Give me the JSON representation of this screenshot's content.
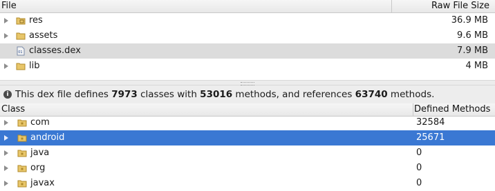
{
  "file_table": {
    "headers": {
      "file": "File",
      "size": "Raw File Size"
    },
    "rows": [
      {
        "name": "res",
        "size": "36.9 MB",
        "icon": "resource-folder-icon"
      },
      {
        "name": "assets",
        "size": "9.6 MB",
        "icon": "folder-icon"
      },
      {
        "name": "classes.dex",
        "size": "7.9 MB",
        "icon": "dex-file-icon"
      },
      {
        "name": "lib",
        "size": "4 MB",
        "icon": "folder-icon"
      }
    ]
  },
  "info_bar": {
    "prefix": "This dex file defines ",
    "classes": "7973",
    "mid1": " classes with ",
    "methods": "53016",
    "mid2": " methods, and references ",
    "references": "63740",
    "suffix": " methods."
  },
  "class_table": {
    "headers": {
      "class": "Class",
      "methods": "Defined Methods"
    },
    "rows": [
      {
        "name": "com",
        "count": "32584"
      },
      {
        "name": "android",
        "count": "25671"
      },
      {
        "name": "java",
        "count": "0"
      },
      {
        "name": "org",
        "count": "0"
      },
      {
        "name": "javax",
        "count": "0"
      }
    ]
  },
  "colors": {
    "selection_blue": "#3a78d3",
    "selection_gray": "#dcdcdc",
    "folder": "#c9a244"
  }
}
